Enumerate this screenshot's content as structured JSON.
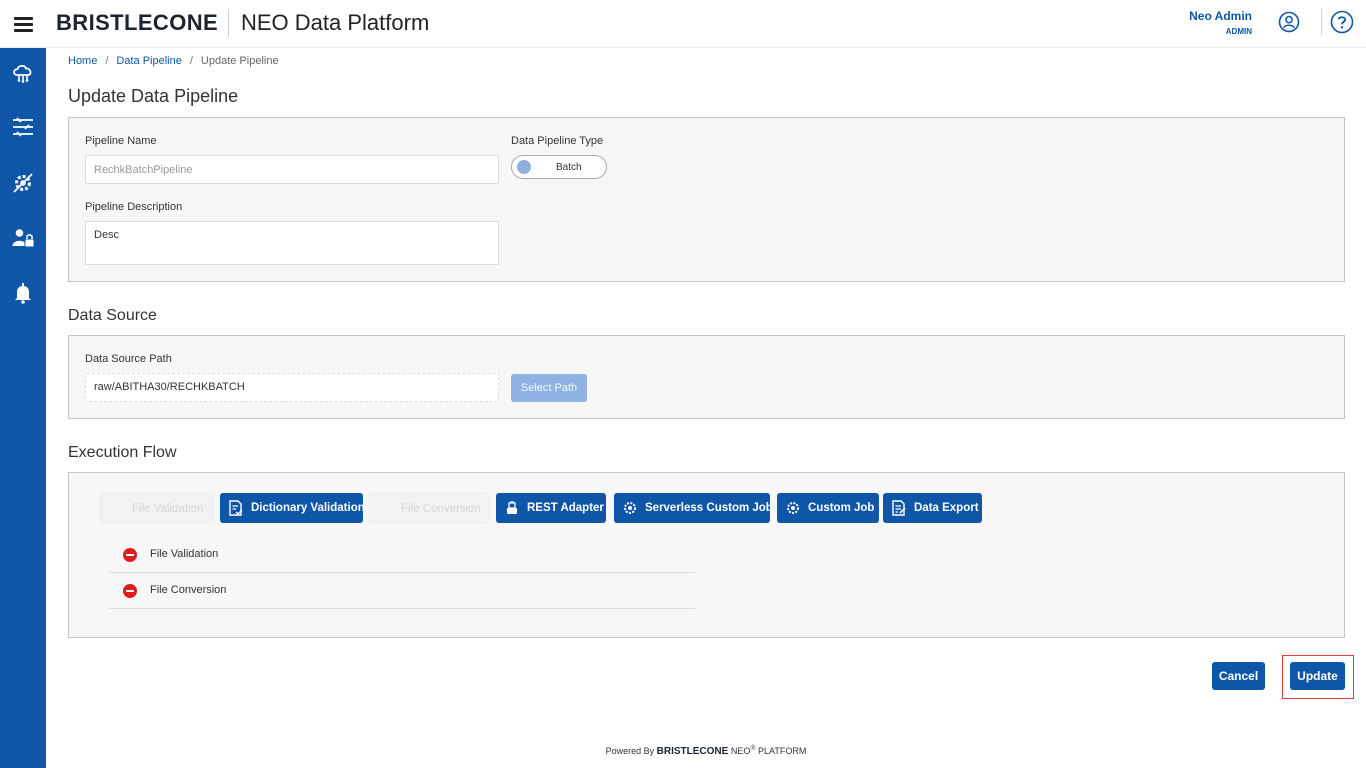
{
  "header": {
    "logo_text": "BRISTLECONE",
    "app_title": "NEO Data Platform",
    "user_name": "Neo Admin",
    "user_role": "ADMIN"
  },
  "sidebar": {
    "items": [
      {
        "icon": "cloud-data-icon"
      },
      {
        "icon": "pipeline-icon"
      },
      {
        "icon": "settings-gear-icon"
      },
      {
        "icon": "user-admin-icon"
      },
      {
        "icon": "bell-icon"
      }
    ]
  },
  "breadcrumb": {
    "home": "Home",
    "data_pipeline": "Data Pipeline",
    "current": "Update Pipeline",
    "separator": "/"
  },
  "page_title": "Update Data Pipeline",
  "pipeline": {
    "name_label": "Pipeline Name",
    "name_value": "RechkBatchPipeline",
    "type_label": "Data Pipeline Type",
    "type_value": "Batch",
    "description_label": "Pipeline Description",
    "description_value": "Desc"
  },
  "data_source": {
    "section_title": "Data Source",
    "path_label": "Data Source Path",
    "path_value": "raw/ABITHA30/RECHKBATCH",
    "select_path_label": "Select Path"
  },
  "execution_flow": {
    "section_title": "Execution Flow",
    "buttons": [
      {
        "label": "File Validation",
        "enabled": false
      },
      {
        "label": "Dictionary Validation",
        "enabled": true
      },
      {
        "label": "File Conversion",
        "enabled": false
      },
      {
        "label": "REST Adapter",
        "enabled": true
      },
      {
        "label": "Serverless Custom Job",
        "enabled": true
      },
      {
        "label": "Custom Job",
        "enabled": true
      },
      {
        "label": "Data Export",
        "enabled": true
      }
    ],
    "selected_steps": [
      {
        "label": "File Validation"
      },
      {
        "label": "File Conversion"
      }
    ]
  },
  "actions": {
    "cancel_label": "Cancel",
    "update_label": "Update"
  },
  "footer": {
    "powered_by": "Powered By",
    "brand": "BRISTLECONE",
    "neo": "NEO",
    "registered": "®",
    "platform": "PLATFORM"
  },
  "colors": {
    "primary": "#0f56a8",
    "disabled_button": "#8fb3e3",
    "remove_red": "#e01b1b",
    "highlight_outline": "#e23c3c"
  }
}
